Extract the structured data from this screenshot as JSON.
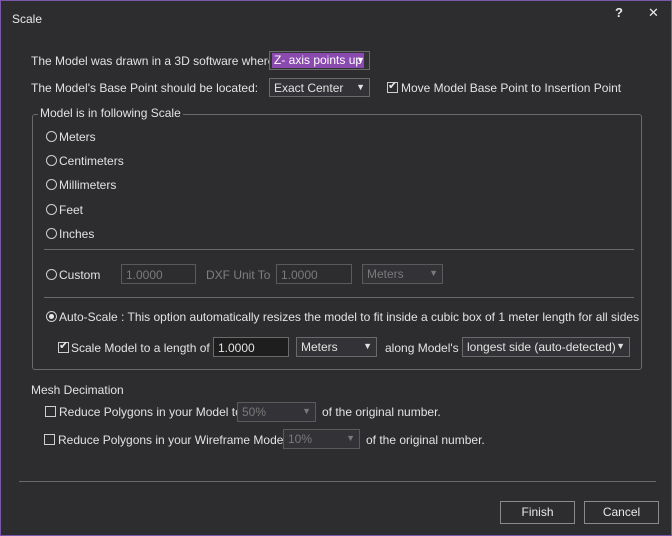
{
  "window": {
    "title": "Scale",
    "help_label": "?",
    "close_label": "✕"
  },
  "top": {
    "drawn_label": "The Model was drawn in a 3D software where :",
    "axis_value": "Z- axis points up",
    "base_label": "The Model's Base Point should be located:",
    "base_value": "Exact Center",
    "move_label": "Move Model Base Point to Insertion Point",
    "move_checked": true
  },
  "scale_group": {
    "legend": "Model is in following Scale",
    "units": [
      "Meters",
      "Centimeters",
      "Millimeters",
      "Feet",
      "Inches"
    ],
    "custom": {
      "label": "Custom",
      "value": "1.0000",
      "dxf_label": "DXF Unit To",
      "dxf_value": "1.0000",
      "unit_value": "Meters"
    },
    "auto": {
      "label": "Auto-Scale : This option automatically resizes the model to fit inside a cubic box of 1 meter length for all sides",
      "checked": true,
      "scale_label": "Scale Model to a length of",
      "scale_value": "1.0000",
      "unit_value": "Meters",
      "along_label": "along Model's",
      "side_value": "longest side (auto-detected)"
    }
  },
  "mesh": {
    "title": "Mesh Decimation",
    "reduce_label": "Reduce Polygons in your Model to",
    "reduce_value": "50%",
    "reduce_suffix": "of the original number.",
    "wire_label": "Reduce Polygons in your Wireframe Model to",
    "wire_value": "10%",
    "wire_suffix": "of the original number."
  },
  "buttons": {
    "finish": "Finish",
    "cancel": "Cancel"
  },
  "colors": {
    "background": "#2d2d30",
    "border": "#7a5aa8",
    "highlight": "#8a4ab0"
  }
}
